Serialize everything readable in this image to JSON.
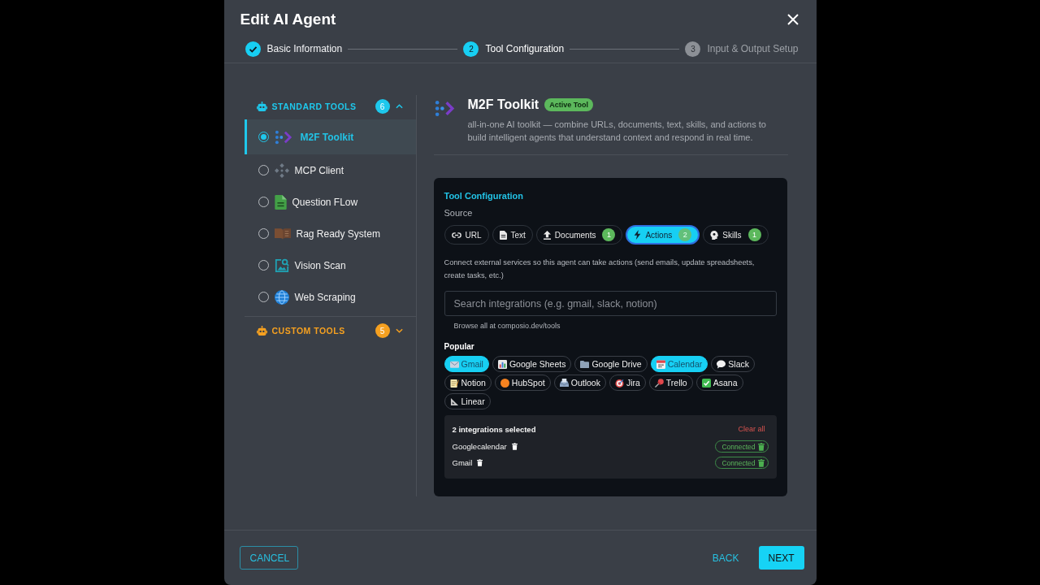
{
  "dialog": {
    "title": "Edit AI Agent"
  },
  "stepper": {
    "steps": [
      {
        "label": "Basic Information",
        "completed": true,
        "selected": false
      },
      {
        "number": "2",
        "label": "Tool Configuration",
        "completed": false,
        "selected": true
      },
      {
        "number": "3",
        "label": "Input & Output Setup",
        "completed": false,
        "selected": false
      }
    ]
  },
  "sidebar": {
    "groups": [
      {
        "title": "STANDARD TOOLS",
        "count": "6",
        "color": "#1ec8ec",
        "expanded": true,
        "items": [
          {
            "label": "M2F Toolkit",
            "selected": true
          },
          {
            "label": "MCP Client",
            "selected": false
          },
          {
            "label": "Question FLow",
            "selected": false
          },
          {
            "label": "Rag Ready System",
            "selected": false
          },
          {
            "label": "Vision Scan",
            "selected": false
          },
          {
            "label": "Web Scraping",
            "selected": false
          }
        ]
      },
      {
        "title": "CUSTOM TOOLS",
        "count": "5",
        "color": "#f5a020",
        "expanded": false
      }
    ]
  },
  "tool": {
    "title": "M2F Toolkit",
    "badge": "Active Tool",
    "description": "all-in-one AI toolkit — combine URLs, documents, text, skills, and actions to build intelligent agents that understand context and respond in real time."
  },
  "config": {
    "title": "Tool Configuration",
    "source_label": "Source",
    "sources": [
      {
        "label": "URL",
        "selected": false
      },
      {
        "label": "Text",
        "selected": false
      },
      {
        "label": "Documents",
        "count": "1",
        "selected": false
      },
      {
        "label": "Actions",
        "count": "2",
        "selected": true
      },
      {
        "label": "Skills",
        "count": "1",
        "selected": false
      }
    ],
    "help": "Connect external services so this agent can take actions (send emails, update spreadsheets, create tasks, etc.)",
    "search": {
      "placeholder": "Search integrations (e.g. gmail, slack, notion)"
    },
    "hint": "Browse all at composio.dev/tools",
    "popular_label": "Popular",
    "popular": [
      {
        "label": "Gmail",
        "selected": true
      },
      {
        "label": "Google Sheets",
        "selected": false
      },
      {
        "label": "Google Drive",
        "selected": false
      },
      {
        "label": "Calendar",
        "selected": true
      },
      {
        "label": "Slack",
        "selected": false
      },
      {
        "label": "Notion",
        "selected": false
      },
      {
        "label": "HubSpot",
        "selected": false
      },
      {
        "label": "Outlook",
        "selected": false
      },
      {
        "label": "Jira",
        "selected": false
      },
      {
        "label": "Trello",
        "selected": false
      },
      {
        "label": "Asana",
        "selected": false
      },
      {
        "label": "Linear",
        "selected": false
      }
    ],
    "selection": {
      "summary": "2 integrations selected",
      "clear": "Clear all",
      "items": [
        {
          "name": "Googlecalendar",
          "status": "Connected"
        },
        {
          "name": "Gmail",
          "status": "Connected"
        }
      ]
    }
  },
  "footer": {
    "buttons": [
      {
        "label": "CANCEL",
        "kind": "outlined"
      },
      {
        "label": "BACK",
        "kind": "text"
      },
      {
        "label": "NEXT",
        "kind": "primary"
      }
    ]
  }
}
